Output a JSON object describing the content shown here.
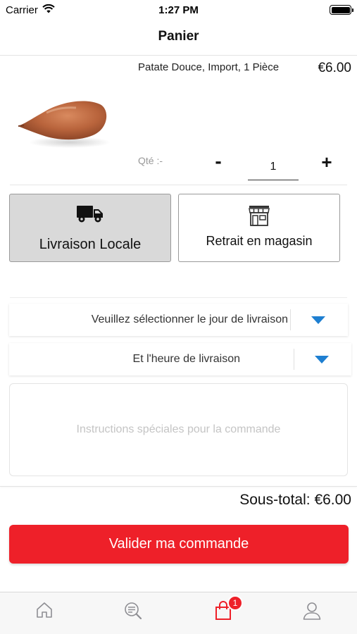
{
  "status_bar": {
    "carrier": "Carrier",
    "time": "1:27 PM"
  },
  "nav": {
    "title": "Panier"
  },
  "cart_item": {
    "name": "Patate Douce, Import, 1 Pièce",
    "price": "€6.00",
    "image_icon": "sweet-potato-image",
    "qty_label": "Qté :-",
    "qty_minus": "-",
    "qty_value": "1",
    "qty_plus": "+"
  },
  "delivery": {
    "options": [
      {
        "label": "Livraison Locale",
        "icon": "truck-icon",
        "selected": true
      },
      {
        "label": "Retrait en magasin",
        "icon": "store-icon",
        "selected": false
      }
    ],
    "day_select": {
      "text": "Veuillez sélectionner le jour de livraison"
    },
    "time_select": {
      "text": "Et l'heure de livraison"
    },
    "caret_color": "#1e7fd1"
  },
  "instructions": {
    "placeholder": "Instructions spéciales pour la commande",
    "value": ""
  },
  "summary": {
    "subtotal": "Sous-total: €6.00"
  },
  "checkout": {
    "label": "Valider ma commande",
    "color": "#ee2029"
  },
  "tab_bar": {
    "tabs": [
      {
        "icon": "home-icon",
        "active": false
      },
      {
        "icon": "search-list-icon",
        "active": false
      },
      {
        "icon": "shopping-bag-icon",
        "active": true,
        "badge": "1"
      },
      {
        "icon": "user-icon",
        "active": false
      }
    ],
    "active_color": "#ee2029",
    "inactive_color": "#8e8e93"
  }
}
